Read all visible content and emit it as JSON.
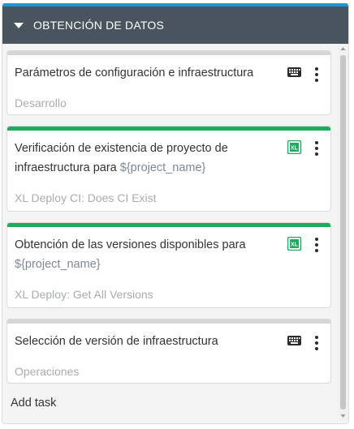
{
  "section": {
    "title": "OBTENCIÓN DE DATOS",
    "header_color": "#49545f",
    "accent_color": "#1a99d6"
  },
  "tasks": [
    {
      "title": "Parámetros de configuración e infraestructura",
      "variable": "",
      "subtitle": "Desarrollo",
      "icon": "keyboard-icon",
      "bar_color": "#d6d6d6"
    },
    {
      "title": "Verificación de existencia de proyecto de infraestructura para",
      "variable": "${project_name}",
      "subtitle": "XL Deploy CI: Does CI Exist",
      "icon": "xl-deploy-icon",
      "bar_color": "#1fab5f"
    },
    {
      "title": "Obtención de las versiones disponibles para",
      "variable": "${project_name}",
      "subtitle": "XL Deploy: Get All Versions",
      "icon": "xl-deploy-icon",
      "bar_color": "#1fab5f"
    },
    {
      "title": "Selección de versión de infraestructura",
      "variable": "",
      "subtitle": "Operaciones",
      "icon": "keyboard-icon",
      "bar_color": "#d6d6d6"
    }
  ],
  "add_task_label": "Add task"
}
